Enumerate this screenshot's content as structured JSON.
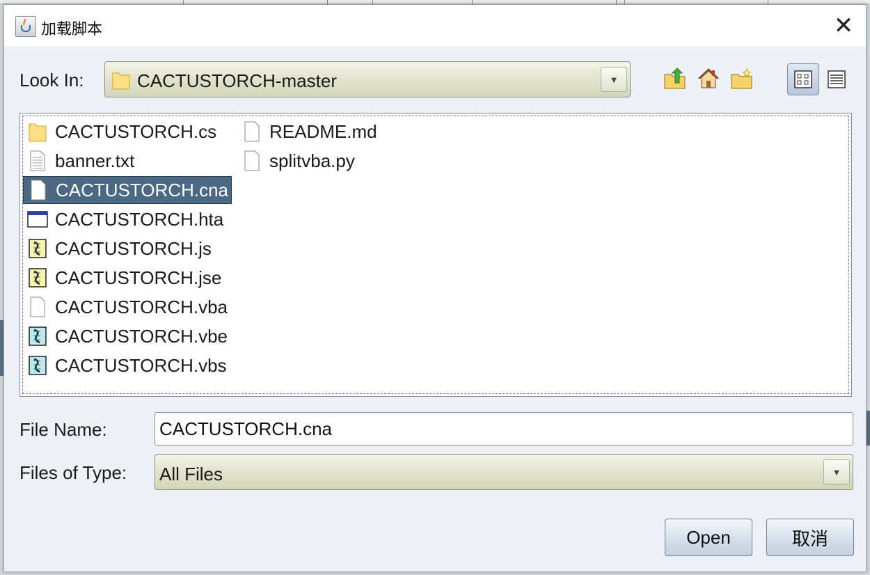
{
  "dialog": {
    "title": "加载脚本",
    "close_glyph": "✕"
  },
  "look_in": {
    "label": "Look In:",
    "value": "CACTUSTORCH-master"
  },
  "files": [
    {
      "name": "CACTUSTORCH.cs",
      "icon": "folder-icon",
      "selected": false
    },
    {
      "name": "banner.txt",
      "icon": "text-file-icon",
      "selected": false
    },
    {
      "name": "CACTUSTORCH.cna",
      "icon": "file-icon",
      "selected": true
    },
    {
      "name": "CACTUSTORCH.hta",
      "icon": "window-file-icon",
      "selected": false
    },
    {
      "name": "CACTUSTORCH.js",
      "icon": "script-file-icon",
      "selected": false
    },
    {
      "name": "CACTUSTORCH.jse",
      "icon": "script-file-icon",
      "selected": false
    },
    {
      "name": "CACTUSTORCH.vba",
      "icon": "file-icon",
      "selected": false
    },
    {
      "name": "CACTUSTORCH.vbe",
      "icon": "vb-script-file-icon",
      "selected": false
    },
    {
      "name": "CACTUSTORCH.vbs",
      "icon": "vb-script-file-icon",
      "selected": false
    },
    {
      "name": "README.md",
      "icon": "file-icon",
      "selected": false
    },
    {
      "name": "splitvba.py",
      "icon": "file-icon",
      "selected": false
    }
  ],
  "file_name": {
    "label": "File Name:",
    "value": "CACTUSTORCH.cna"
  },
  "files_of_type": {
    "label": "Files of Type:",
    "value": "All Files"
  },
  "buttons": {
    "open": "Open",
    "cancel": "取消"
  },
  "colors": {
    "selection": "#4b6985",
    "dialog_bg": "#eef0f5",
    "combo_bg": "#dfe2c9"
  }
}
